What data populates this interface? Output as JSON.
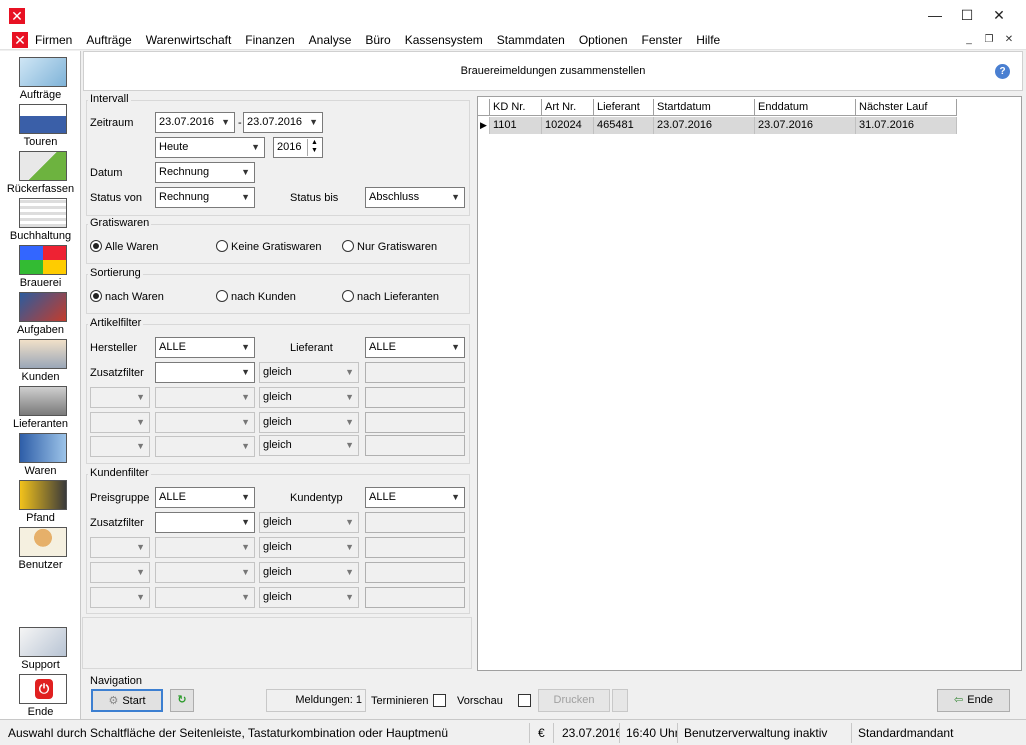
{
  "window": {
    "minimize": "—",
    "maximize": "☐",
    "close": "✕"
  },
  "menu": [
    "Firmen",
    "Aufträge",
    "Warenwirtschaft",
    "Finanzen",
    "Analyse",
    "Büro",
    "Kassensystem",
    "Stammdaten",
    "Optionen",
    "Fenster",
    "Hilfe"
  ],
  "sidebar": [
    {
      "label": "Aufträge",
      "icon": "orders-icon"
    },
    {
      "label": "Touren",
      "icon": "truck-icon"
    },
    {
      "label": "Rückerfassen",
      "icon": "truck-check-icon"
    },
    {
      "label": "Buchhaltung",
      "icon": "accounting-icon"
    },
    {
      "label": "Brauerei",
      "icon": "brewery-icon"
    },
    {
      "label": "Aufgaben",
      "icon": "tasks-icon"
    },
    {
      "label": "Kunden",
      "icon": "customers-icon"
    },
    {
      "label": "Lieferanten",
      "icon": "suppliers-icon"
    },
    {
      "label": "Waren",
      "icon": "goods-icon"
    },
    {
      "label": "Pfand",
      "icon": "deposit-icon"
    },
    {
      "label": "Benutzer",
      "icon": "user-icon"
    },
    {
      "label": "Support",
      "icon": "support-icon"
    },
    {
      "label": "Ende",
      "icon": "power-icon"
    }
  ],
  "header": {
    "title": "Brauereimeldungen zusammenstellen"
  },
  "intervall": {
    "title": "Intervall",
    "zeitraum_label": "Zeitraum",
    "from": "23.07.2016",
    "separator": "-",
    "to": "23.07.2016",
    "period": "Heute",
    "year": "2016",
    "datum_label": "Datum",
    "datum": "Rechnung",
    "status_von_label": "Status von",
    "status_von": "Rechnung",
    "status_bis_label": "Status bis",
    "status_bis": "Abschluss"
  },
  "gratiswaren": {
    "title": "Gratiswaren",
    "options": [
      "Alle Waren",
      "Keine Gratiswaren",
      "Nur Gratiswaren"
    ],
    "selected": 0
  },
  "sortierung": {
    "title": "Sortierung",
    "options": [
      "nach Waren",
      "nach Kunden",
      "nach Lieferanten"
    ],
    "selected": 0
  },
  "artikelfilter": {
    "title": "Artikelfilter",
    "hersteller_label": "Hersteller",
    "hersteller": "ALLE",
    "lieferant_label": "Lieferant",
    "lieferant": "ALLE",
    "zusatzfilter_label": "Zusatzfilter",
    "operator": "gleich"
  },
  "kundenfilter": {
    "title": "Kundenfilter",
    "preisgruppe_label": "Preisgruppe",
    "preisgruppe": "ALLE",
    "kundentyp_label": "Kundentyp",
    "kundentyp": "ALLE",
    "zusatzfilter_label": "Zusatzfilter",
    "operator": "gleich"
  },
  "grid": {
    "columns": [
      "KD Nr.",
      "Art Nr.",
      "Lieferant",
      "Startdatum",
      "Enddatum",
      "Nächster Lauf"
    ],
    "rows": [
      [
        "1101",
        "102024",
        "465481",
        "23.07.2016",
        "23.07.2016",
        "31.07.2016"
      ]
    ]
  },
  "navigation": {
    "title": "Navigation",
    "start": "Start",
    "meldungen": "Meldungen: 1",
    "terminieren": "Terminieren",
    "vorschau": "Vorschau",
    "drucken": "Drucken",
    "ende": "Ende"
  },
  "status": {
    "hint": "Auswahl durch Schaltfläche der Seitenleiste, Tastaturkombination oder Hauptmenü",
    "currency": "€",
    "date": "23.07.2016",
    "time": "16:40 Uhr",
    "userinfo": "Benutzerverwaltung inaktiv",
    "mandant": "Standardmandant"
  }
}
